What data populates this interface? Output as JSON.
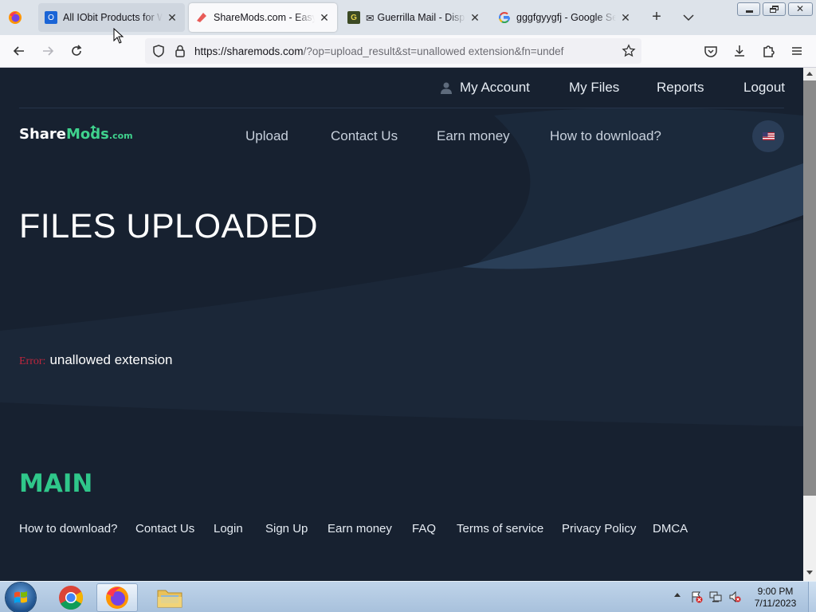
{
  "browser": {
    "tabs": [
      {
        "title": "All IObit Products for Wi",
        "favicon": "iobit-icon"
      },
      {
        "title": "ShareMods.com - Easy w",
        "favicon": "sharemods-icon"
      },
      {
        "title": "Guerrilla Mail - Dispos",
        "favicon": "guerrilla-mail-icon",
        "prefix": "✉"
      },
      {
        "title": "gggfgyygfj - Google Sear",
        "favicon": "google-icon"
      }
    ],
    "url_host": "https://sharemods.com",
    "url_rest": "/?op=upload_result&st=unallowed extension&fn=undef"
  },
  "site": {
    "top_nav": {
      "account": "My Account",
      "files": "My Files",
      "reports": "Reports",
      "logout": "Logout"
    },
    "logo": {
      "share": "Share",
      "mods": "Mods",
      "com": ".com"
    },
    "main_nav": {
      "upload": "Upload",
      "contact": "Contact Us",
      "earn": "Earn money",
      "how": "How to download?"
    },
    "heading": "FILES UPLOADED",
    "error": {
      "label": "Error:",
      "message": "unallowed extension"
    },
    "footer": {
      "heading": "MAIN",
      "links": [
        "How to download?",
        "Contact Us",
        "Login",
        "Sign Up",
        "Earn money",
        "FAQ",
        "Terms of service",
        "Privacy Policy",
        "DMCA"
      ]
    }
  },
  "taskbar": {
    "time": "9:00 PM",
    "date": "7/11/2023"
  },
  "colors": {
    "page_bg": "#172130",
    "accent_green": "#2fc78a",
    "error_red": "#c0263d"
  }
}
